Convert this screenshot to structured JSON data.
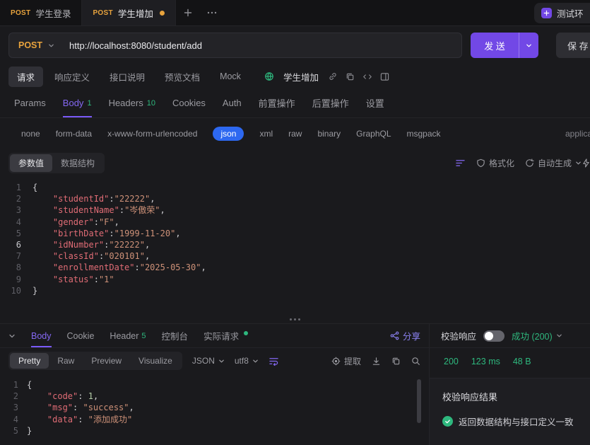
{
  "window": {
    "tabs": [
      {
        "method": "POST",
        "label": "学生登录"
      },
      {
        "method": "POST",
        "label": "学生增加"
      }
    ],
    "environment": "测试环"
  },
  "request_bar": {
    "method": "POST",
    "url": "http://localhost:8080/student/add",
    "send_label": "发 送",
    "save_label": "保 存"
  },
  "nav": {
    "items": [
      "请求",
      "响应定义",
      "接口说明",
      "预览文档",
      "Mock"
    ],
    "doc_title": "学生增加"
  },
  "section_tabs": [
    {
      "label": "Params"
    },
    {
      "label": "Body",
      "badge": "1"
    },
    {
      "label": "Headers",
      "badge": "10"
    },
    {
      "label": "Cookies"
    },
    {
      "label": "Auth"
    },
    {
      "label": "前置操作"
    },
    {
      "label": "后置操作"
    },
    {
      "label": "设置"
    }
  ],
  "body_types": {
    "options": [
      "none",
      "form-data",
      "x-www-form-urlencoded",
      "json",
      "xml",
      "raw",
      "binary",
      "GraphQL",
      "msgpack"
    ],
    "selected": "json",
    "content_type": "application/json"
  },
  "editor_toolbar": {
    "values_tab": "参数值",
    "schema_tab": "数据结构",
    "format_label": "格式化",
    "auto_label": "自动生成"
  },
  "request_editor": {
    "language": "json",
    "active_line": 6,
    "indent": "    ",
    "colon": ":",
    "entries": [
      {
        "key": "studentId",
        "value": "22222",
        "quoted": true
      },
      {
        "key": "studentName",
        "value": "岑傲荣",
        "quoted": true
      },
      {
        "key": "gender",
        "value": "F",
        "quoted": true
      },
      {
        "key": "birthDate",
        "value": "1999-11-20",
        "quoted": true
      },
      {
        "key": "idNumber",
        "value": "22222",
        "quoted": true
      },
      {
        "key": "classId",
        "value": "020101",
        "quoted": true
      },
      {
        "key": "enrollmentDate",
        "value": "2025-05-30",
        "quoted": true
      },
      {
        "key": "status",
        "value": "1",
        "quoted": true
      }
    ]
  },
  "response_tabs": {
    "body": "Body",
    "cookie": "Cookie",
    "header": "Header",
    "header_badge": "5",
    "console": "控制台",
    "actual": "实际请求",
    "share": "分享"
  },
  "response_toolbar": {
    "views": [
      "Pretty",
      "Raw",
      "Preview",
      "Visualize"
    ],
    "active_view": "Pretty",
    "language": "JSON",
    "encoding": "utf8",
    "extract": "提取"
  },
  "response_editor": {
    "language": "json",
    "active_line": 0,
    "indent": "    ",
    "colon": ": ",
    "entries": [
      {
        "key": "code",
        "value": "1",
        "quoted": false
      },
      {
        "key": "msg",
        "value": "success",
        "quoted": true
      },
      {
        "key": "data",
        "value": "添加成功",
        "quoted": true
      }
    ]
  },
  "validation": {
    "label": "校验响应",
    "status": "成功 (200)",
    "metrics": [
      {
        "value": "200"
      },
      {
        "value": "123 ms"
      },
      {
        "value": "48 B"
      }
    ],
    "result_title": "校验响应结果",
    "result_text": "返回数据结构与接口定义一致"
  },
  "colors": {
    "accent_purple": "#7a5af8",
    "method_orange": "#e8a33d",
    "success_green": "#2eb87e",
    "json_pill_blue": "#2d68f0",
    "code_key": "#e06c75",
    "code_string": "#ce9178",
    "code_number": "#b5cea8"
  }
}
